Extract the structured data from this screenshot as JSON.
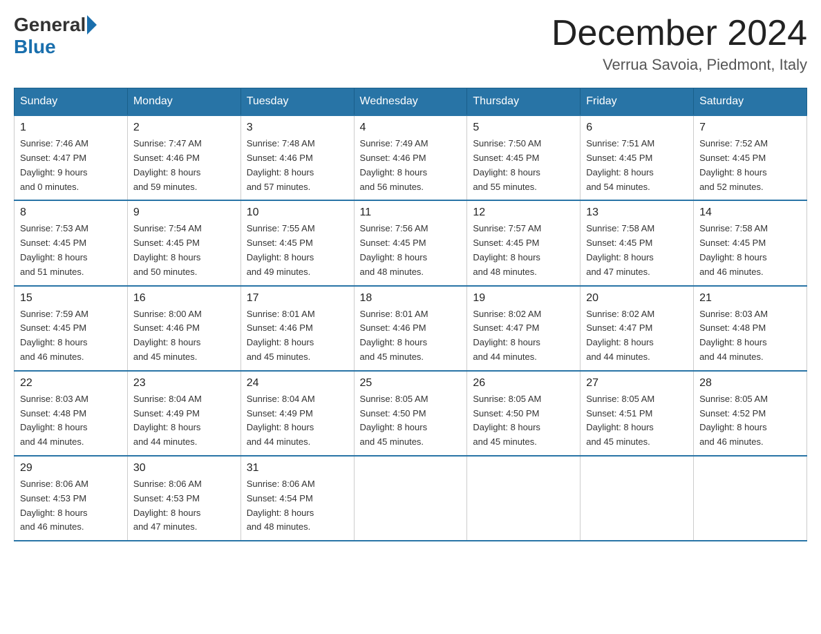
{
  "logo": {
    "text_general": "General",
    "text_blue": "Blue"
  },
  "title": {
    "month_year": "December 2024",
    "location": "Verrua Savoia, Piedmont, Italy"
  },
  "headers": [
    "Sunday",
    "Monday",
    "Tuesday",
    "Wednesday",
    "Thursday",
    "Friday",
    "Saturday"
  ],
  "weeks": [
    [
      {
        "day": "1",
        "sunrise": "7:46 AM",
        "sunset": "4:47 PM",
        "daylight": "9 hours and 0 minutes."
      },
      {
        "day": "2",
        "sunrise": "7:47 AM",
        "sunset": "4:46 PM",
        "daylight": "8 hours and 59 minutes."
      },
      {
        "day": "3",
        "sunrise": "7:48 AM",
        "sunset": "4:46 PM",
        "daylight": "8 hours and 57 minutes."
      },
      {
        "day": "4",
        "sunrise": "7:49 AM",
        "sunset": "4:46 PM",
        "daylight": "8 hours and 56 minutes."
      },
      {
        "day": "5",
        "sunrise": "7:50 AM",
        "sunset": "4:45 PM",
        "daylight": "8 hours and 55 minutes."
      },
      {
        "day": "6",
        "sunrise": "7:51 AM",
        "sunset": "4:45 PM",
        "daylight": "8 hours and 54 minutes."
      },
      {
        "day": "7",
        "sunrise": "7:52 AM",
        "sunset": "4:45 PM",
        "daylight": "8 hours and 52 minutes."
      }
    ],
    [
      {
        "day": "8",
        "sunrise": "7:53 AM",
        "sunset": "4:45 PM",
        "daylight": "8 hours and 51 minutes."
      },
      {
        "day": "9",
        "sunrise": "7:54 AM",
        "sunset": "4:45 PM",
        "daylight": "8 hours and 50 minutes."
      },
      {
        "day": "10",
        "sunrise": "7:55 AM",
        "sunset": "4:45 PM",
        "daylight": "8 hours and 49 minutes."
      },
      {
        "day": "11",
        "sunrise": "7:56 AM",
        "sunset": "4:45 PM",
        "daylight": "8 hours and 48 minutes."
      },
      {
        "day": "12",
        "sunrise": "7:57 AM",
        "sunset": "4:45 PM",
        "daylight": "8 hours and 48 minutes."
      },
      {
        "day": "13",
        "sunrise": "7:58 AM",
        "sunset": "4:45 PM",
        "daylight": "8 hours and 47 minutes."
      },
      {
        "day": "14",
        "sunrise": "7:58 AM",
        "sunset": "4:45 PM",
        "daylight": "8 hours and 46 minutes."
      }
    ],
    [
      {
        "day": "15",
        "sunrise": "7:59 AM",
        "sunset": "4:45 PM",
        "daylight": "8 hours and 46 minutes."
      },
      {
        "day": "16",
        "sunrise": "8:00 AM",
        "sunset": "4:46 PM",
        "daylight": "8 hours and 45 minutes."
      },
      {
        "day": "17",
        "sunrise": "8:01 AM",
        "sunset": "4:46 PM",
        "daylight": "8 hours and 45 minutes."
      },
      {
        "day": "18",
        "sunrise": "8:01 AM",
        "sunset": "4:46 PM",
        "daylight": "8 hours and 45 minutes."
      },
      {
        "day": "19",
        "sunrise": "8:02 AM",
        "sunset": "4:47 PM",
        "daylight": "8 hours and 44 minutes."
      },
      {
        "day": "20",
        "sunrise": "8:02 AM",
        "sunset": "4:47 PM",
        "daylight": "8 hours and 44 minutes."
      },
      {
        "day": "21",
        "sunrise": "8:03 AM",
        "sunset": "4:48 PM",
        "daylight": "8 hours and 44 minutes."
      }
    ],
    [
      {
        "day": "22",
        "sunrise": "8:03 AM",
        "sunset": "4:48 PM",
        "daylight": "8 hours and 44 minutes."
      },
      {
        "day": "23",
        "sunrise": "8:04 AM",
        "sunset": "4:49 PM",
        "daylight": "8 hours and 44 minutes."
      },
      {
        "day": "24",
        "sunrise": "8:04 AM",
        "sunset": "4:49 PM",
        "daylight": "8 hours and 44 minutes."
      },
      {
        "day": "25",
        "sunrise": "8:05 AM",
        "sunset": "4:50 PM",
        "daylight": "8 hours and 45 minutes."
      },
      {
        "day": "26",
        "sunrise": "8:05 AM",
        "sunset": "4:50 PM",
        "daylight": "8 hours and 45 minutes."
      },
      {
        "day": "27",
        "sunrise": "8:05 AM",
        "sunset": "4:51 PM",
        "daylight": "8 hours and 45 minutes."
      },
      {
        "day": "28",
        "sunrise": "8:05 AM",
        "sunset": "4:52 PM",
        "daylight": "8 hours and 46 minutes."
      }
    ],
    [
      {
        "day": "29",
        "sunrise": "8:06 AM",
        "sunset": "4:53 PM",
        "daylight": "8 hours and 46 minutes."
      },
      {
        "day": "30",
        "sunrise": "8:06 AM",
        "sunset": "4:53 PM",
        "daylight": "8 hours and 47 minutes."
      },
      {
        "day": "31",
        "sunrise": "8:06 AM",
        "sunset": "4:54 PM",
        "daylight": "8 hours and 48 minutes."
      },
      null,
      null,
      null,
      null
    ]
  ],
  "labels": {
    "sunrise": "Sunrise:",
    "sunset": "Sunset:",
    "daylight": "Daylight:"
  }
}
